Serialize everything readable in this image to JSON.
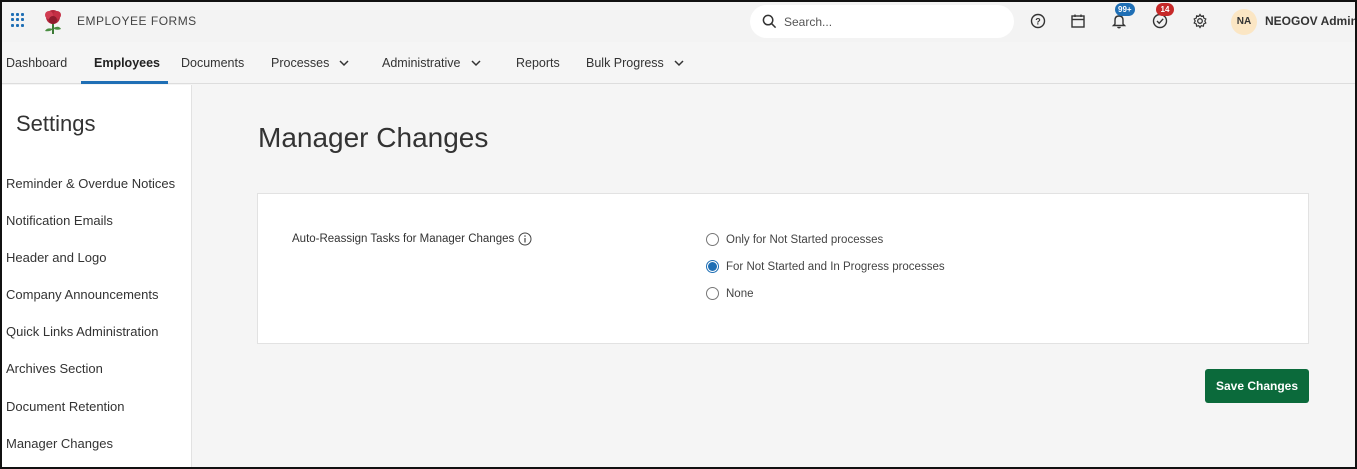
{
  "app": {
    "title": "EMPLOYEE FORMS"
  },
  "search": {
    "placeholder": "Search..."
  },
  "toolbar": {
    "help_icon": "question-circle-icon",
    "calendar_icon": "calendar-icon",
    "notifications_badge": "99+",
    "tasks_badge": "14",
    "settings_icon": "gear-icon"
  },
  "user": {
    "initials": "NA",
    "name": "NEOGOV Admin"
  },
  "nav": {
    "items": [
      {
        "label": "Dashboard"
      },
      {
        "label": "Employees"
      },
      {
        "label": "Documents"
      },
      {
        "label": "Processes"
      },
      {
        "label": "Administrative"
      },
      {
        "label": "Reports"
      },
      {
        "label": "Bulk Progress"
      }
    ],
    "active": "Employees"
  },
  "sidebar": {
    "title": "Settings",
    "items": [
      {
        "label": "Reminder & Overdue Notices"
      },
      {
        "label": "Notification Emails"
      },
      {
        "label": "Header and Logo"
      },
      {
        "label": "Company Announcements"
      },
      {
        "label": "Quick Links Administration"
      },
      {
        "label": "Archives Section"
      },
      {
        "label": "Document Retention"
      },
      {
        "label": "Manager Changes"
      }
    ]
  },
  "main": {
    "title": "Manager Changes",
    "setting_label": "Auto-Reassign Tasks for Manager Changes",
    "options": [
      {
        "label": "Only for Not Started processes",
        "checked": false
      },
      {
        "label": "For Not Started and In Progress processes",
        "checked": true
      },
      {
        "label": "None",
        "checked": false
      }
    ],
    "save_label": "Save Changes"
  },
  "colors": {
    "accent": "#1f6fb5",
    "save_button": "#0b6a3b",
    "notification_badge": "#1f6fb5",
    "tasks_badge": "#c62828"
  }
}
